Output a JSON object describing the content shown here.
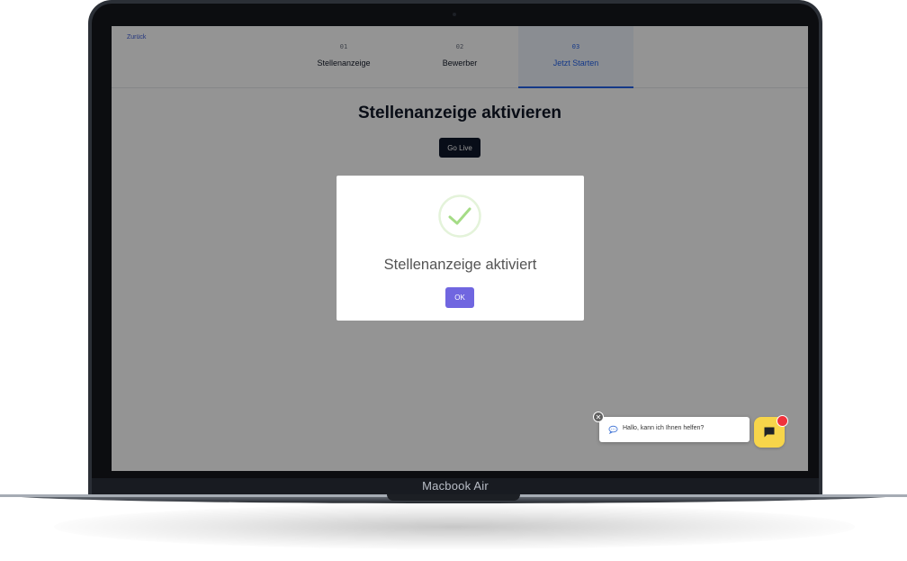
{
  "device": {
    "model_label": "Macbook Air"
  },
  "app": {
    "back_link": "Zurück",
    "steps": [
      {
        "number": "01",
        "label": "Stellenanzeige",
        "active": false
      },
      {
        "number": "02",
        "label": "Bewerber",
        "active": false
      },
      {
        "number": "03",
        "label": "Jetzt Starten",
        "active": true
      }
    ],
    "page_title": "Stellenanzeige aktivieren",
    "go_live_label": "Go Live"
  },
  "modal": {
    "icon": "checkmark-circle-icon",
    "title": "Stellenanzeige aktiviert",
    "ok_label": "OK",
    "accent_color": "#7066e0",
    "success_color": "#a5dc86"
  },
  "chat": {
    "greeting": "Hallo, kann ich Ihnen helfen?",
    "close_icon": "close-icon",
    "launcher_icon": "chat-icon",
    "launcher_color": "#f7d54a",
    "badge_color": "#f0313b"
  }
}
